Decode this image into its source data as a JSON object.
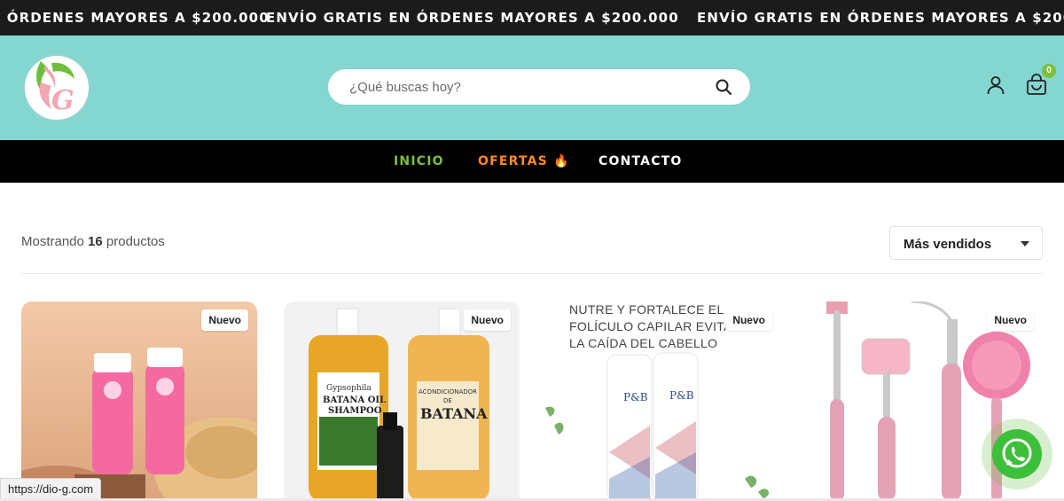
{
  "announcement": {
    "items": [
      "ENVÍO GRATIS EN ÓRDENES MAYORES A $200.000",
      "ENVÍO GRATIS EN ÓRDENES MAYORES A $200.000",
      "ENVÍO GRATIS EN ÓRDENES MAYORES A $200.000"
    ]
  },
  "header": {
    "logo_icon": "dio-g-logo",
    "search": {
      "placeholder": "¿Qué buscas hoy?",
      "value": ""
    },
    "cart_count": "0"
  },
  "nav": {
    "items": [
      {
        "label": "INICIO",
        "color": "#7fbf3a"
      },
      {
        "label": "OFERTAS 🔥",
        "color": "#ff8a1e"
      },
      {
        "label": "CONTACTO",
        "color": "#ffffff"
      }
    ]
  },
  "toolbar": {
    "results_prefix": "Mostrando",
    "results_count": "16",
    "results_suffix": "productos",
    "sort_selected": "Más vendidos"
  },
  "products": [
    {
      "badge": "Nuevo"
    },
    {
      "badge": "Nuevo",
      "image_text": [
        "Gypsophila",
        "BATANA OIL",
        "SHAMPOO",
        "ACONDICIONADOR",
        "DE",
        "BATANA"
      ]
    },
    {
      "badge": "Nuevo",
      "image_text": "NUTRE Y FORTALECE EL FOLÍCULO CAPILAR EVITANDO LA CAÍDA DEL CABELLO"
    },
    {
      "badge": "Nuevo"
    }
  ],
  "status_url": "https://dio-g.com",
  "colors": {
    "header_bg": "#84d6d0",
    "announce_bg": "#1b1b1b",
    "nav_bg": "#000000",
    "whatsapp": "#3cbf3a"
  }
}
